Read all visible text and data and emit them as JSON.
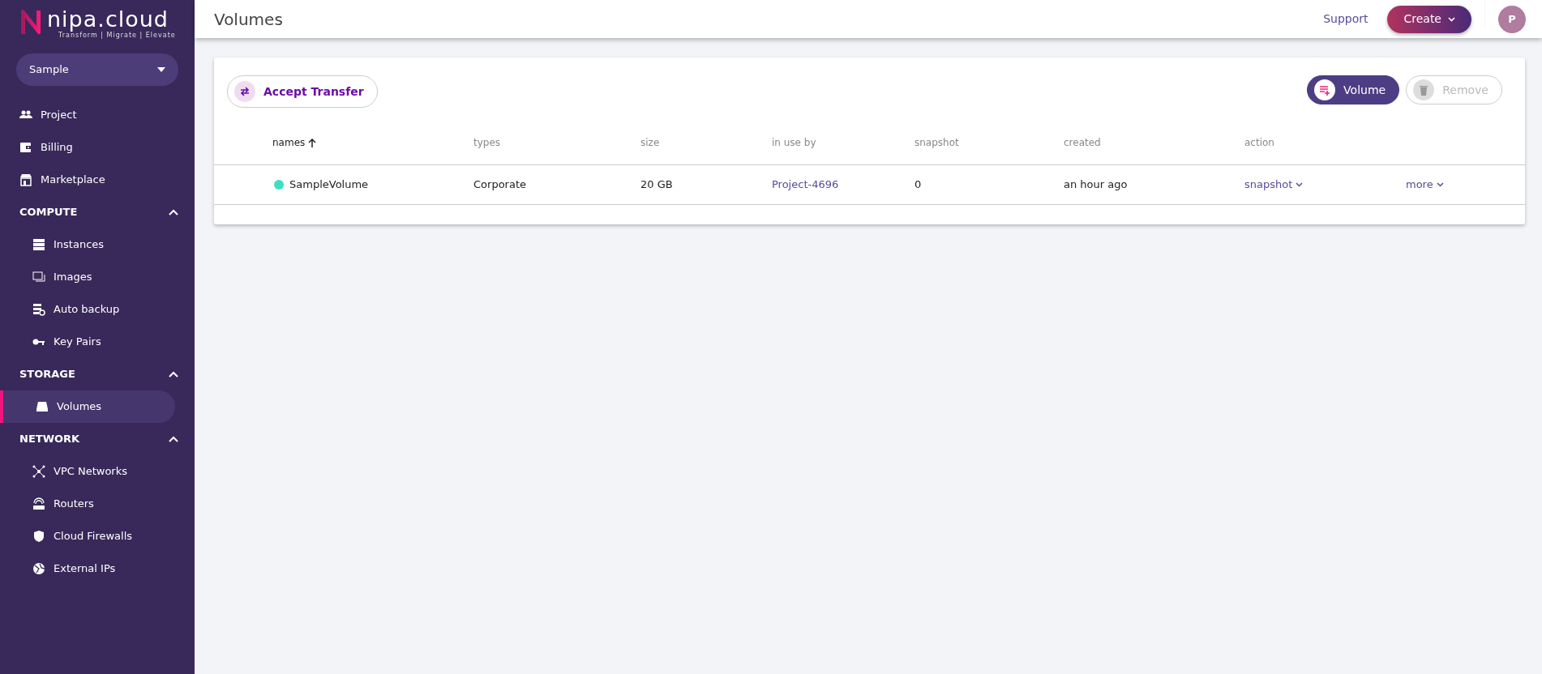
{
  "logo": {
    "wordmark": "nipa.cloud",
    "tagline": "Transform | Migrate | Elevate"
  },
  "project_selector": {
    "value": "Sample"
  },
  "sidebar": {
    "items": [
      {
        "kind": "link",
        "label": "Project",
        "selected": false
      },
      {
        "kind": "link",
        "label": "Billing",
        "selected": false
      },
      {
        "kind": "link",
        "label": "Marketplace",
        "selected": false
      },
      {
        "kind": "section",
        "label": "COMPUTE",
        "expanded": true,
        "children": [
          {
            "label": "Instances",
            "selected": false
          },
          {
            "label": "Images",
            "selected": false
          },
          {
            "label": "Auto backup",
            "selected": false
          },
          {
            "label": "Key Pairs",
            "selected": false
          }
        ]
      },
      {
        "kind": "section",
        "label": "STORAGE",
        "expanded": true,
        "children": [
          {
            "label": "Volumes",
            "selected": true
          }
        ]
      },
      {
        "kind": "section",
        "label": "NETWORK",
        "expanded": true,
        "children": [
          {
            "label": "VPC Networks",
            "selected": false
          },
          {
            "label": "Routers",
            "selected": false
          },
          {
            "label": "Cloud Firewalls",
            "selected": false
          },
          {
            "label": "External IPs",
            "selected": false
          }
        ]
      }
    ]
  },
  "header": {
    "title": "Volumes",
    "support": "Support",
    "create": "Create",
    "avatar": "P"
  },
  "toolbar": {
    "accept_transfer": "Accept Transfer",
    "buttons": [
      {
        "label": "Volume",
        "kind": "add",
        "disabled": false
      },
      {
        "label": "Remove",
        "kind": "remove",
        "disabled": true
      }
    ]
  },
  "table": {
    "columns": [
      {
        "label": "names",
        "sorted": true
      },
      {
        "label": "types",
        "sorted": false
      },
      {
        "label": "size",
        "sorted": false
      },
      {
        "label": "in use by",
        "sorted": false
      },
      {
        "label": "snapshot",
        "sorted": false
      },
      {
        "label": "created",
        "sorted": false
      },
      {
        "label": "action",
        "sorted": false
      }
    ],
    "rows": [
      {
        "color": "#3fe0c0",
        "name": "SampleVolume",
        "type": "Corporate",
        "size": "20 GB",
        "in_use_by": "Project-4696",
        "snapshot": "0",
        "created": "an hour ago",
        "action": "snapshot",
        "more": "more"
      }
    ]
  }
}
